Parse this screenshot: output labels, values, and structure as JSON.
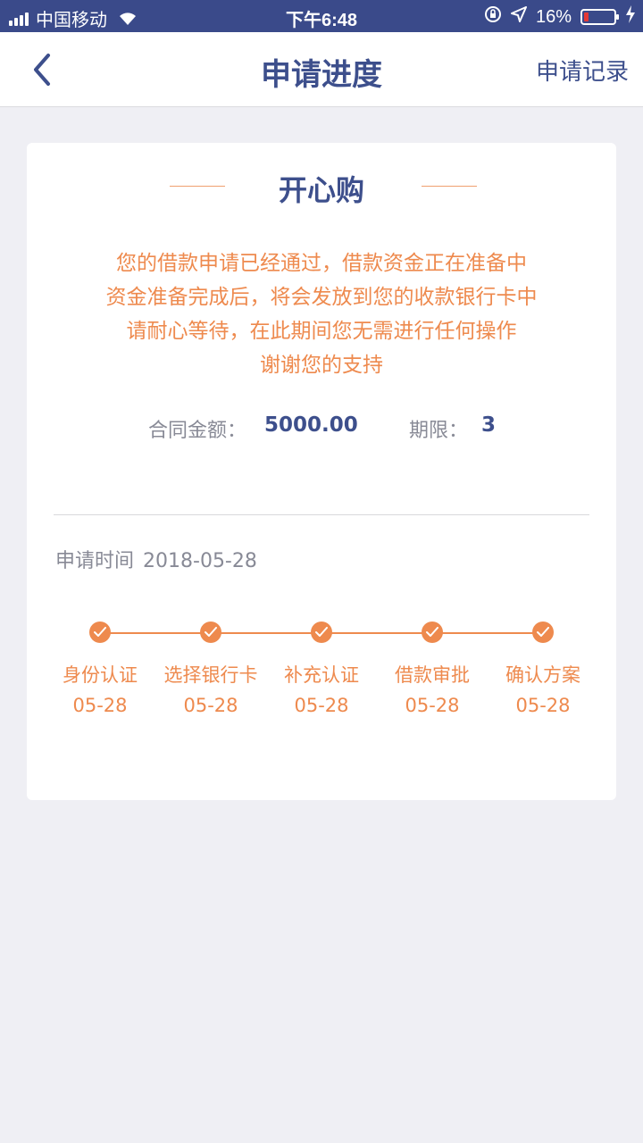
{
  "status_bar": {
    "carrier": "中国移动",
    "time": "下午6:48",
    "battery_percent": "16%",
    "battery_level": 0.16,
    "icons": [
      "signal-icon",
      "wifi-icon",
      "orientation-lock-icon",
      "location-icon",
      "battery-icon",
      "charging-icon"
    ]
  },
  "nav": {
    "back_icon": "chevron-left-icon",
    "title": "申请进度",
    "right_link": "申请记录"
  },
  "card": {
    "title": "开心购",
    "message_lines": [
      "您的借款申请已经通过，借款资金正在准备中",
      "资金准备完成后，将会发放到您的收款银行卡中",
      "请耐心等待，在此期间您无需进行任何操作",
      "谢谢您的支持"
    ],
    "contract_amount_label": "合同金额：",
    "contract_amount": "5000.00",
    "term_label": "期限：",
    "term": "3",
    "apply_time_label": "申请时间",
    "apply_time": "2018-05-28",
    "steps": [
      {
        "label": "身份认证",
        "date": "05-28",
        "status": "done"
      },
      {
        "label": "选择银行卡",
        "date": "05-28",
        "status": "done"
      },
      {
        "label": "补充认证",
        "date": "05-28",
        "status": "done"
      },
      {
        "label": "借款审批",
        "date": "05-28",
        "status": "done"
      },
      {
        "label": "确认方案",
        "date": "05-28",
        "status": "done"
      }
    ]
  },
  "colors": {
    "status_bar_bg": "#3a4a8a",
    "primary_text": "#3d4f8c",
    "accent_orange": "#ee8a4e",
    "muted_text": "#888a96",
    "page_bg": "#efeff4"
  }
}
